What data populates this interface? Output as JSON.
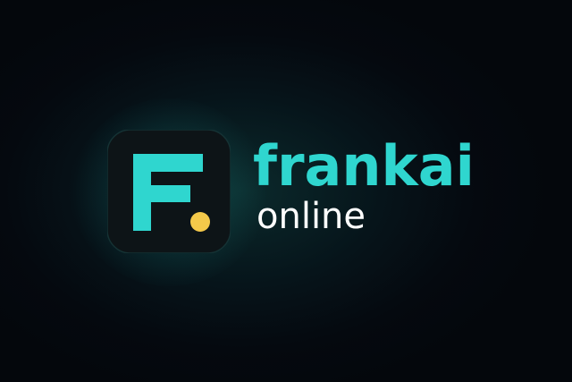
{
  "brand": {
    "name": "frankai",
    "tagline": "online",
    "icon_letter": "F",
    "icon_name": "frankai-app-icon"
  },
  "colors": {
    "background": "#05090f",
    "accent_teal": "#2fd6cf",
    "dot_yellow": "#f4c94a",
    "icon_tile": "#0d1417",
    "tagline_white": "#ffffff"
  }
}
